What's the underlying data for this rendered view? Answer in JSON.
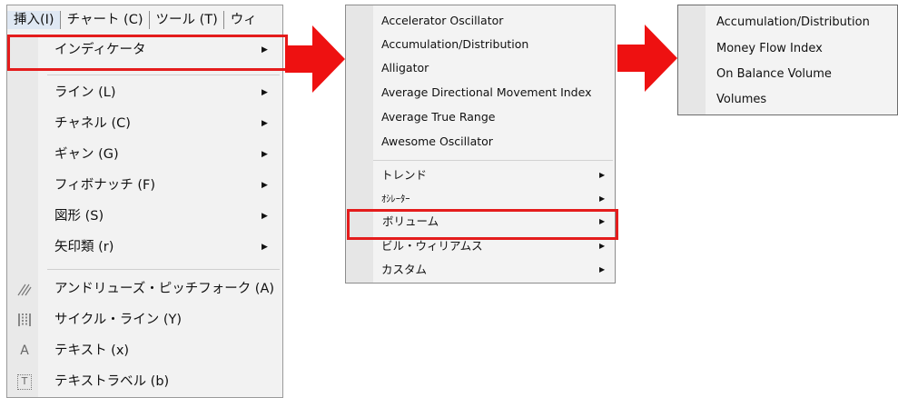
{
  "menubar": {
    "items": [
      {
        "label": "挿入(I)"
      },
      {
        "label": "チャート (C)"
      },
      {
        "label": "ツール (T)"
      },
      {
        "label": "ウィ"
      }
    ]
  },
  "insert_menu": {
    "indicators": "インディケータ",
    "line": "ライン (L)",
    "channel": "チャネル (C)",
    "gann": "ギャン (G)",
    "fibonacci": "フィボナッチ (F)",
    "shapes": "図形 (S)",
    "arrows": "矢印類 (r)",
    "andrews": "アンドリューズ・ピッチフォーク (A)",
    "cycle_lines": "サイクル・ライン (Y)",
    "text": "テキスト (x)",
    "text_label": "テキストラベル (b)",
    "text_icon_glyph": "A",
    "text_label_icon_glyph": "T"
  },
  "indicators_menu": {
    "items": [
      "Accelerator Oscillator",
      "Accumulation/Distribution",
      "Alligator",
      "Average Directional Movement Index",
      "Average True Range",
      "Awesome Oscillator"
    ],
    "trend": "トレンド",
    "oscillators": "ｵｼﾚｰﾀｰ",
    "volumes": "ボリューム",
    "bill_williams": "ビル・ウィリアムス",
    "custom": "カスタム"
  },
  "volumes_menu": {
    "items": [
      "Accumulation/Distribution",
      "Money Flow Index",
      "On Balance Volume",
      "Volumes"
    ]
  },
  "colors": {
    "highlight": "#e41c1c",
    "arrow": "#ee1111",
    "menu_bg": "#f2f2f2",
    "gutter": "#e9e9e9"
  },
  "submenu_arrow_glyph": "▶"
}
